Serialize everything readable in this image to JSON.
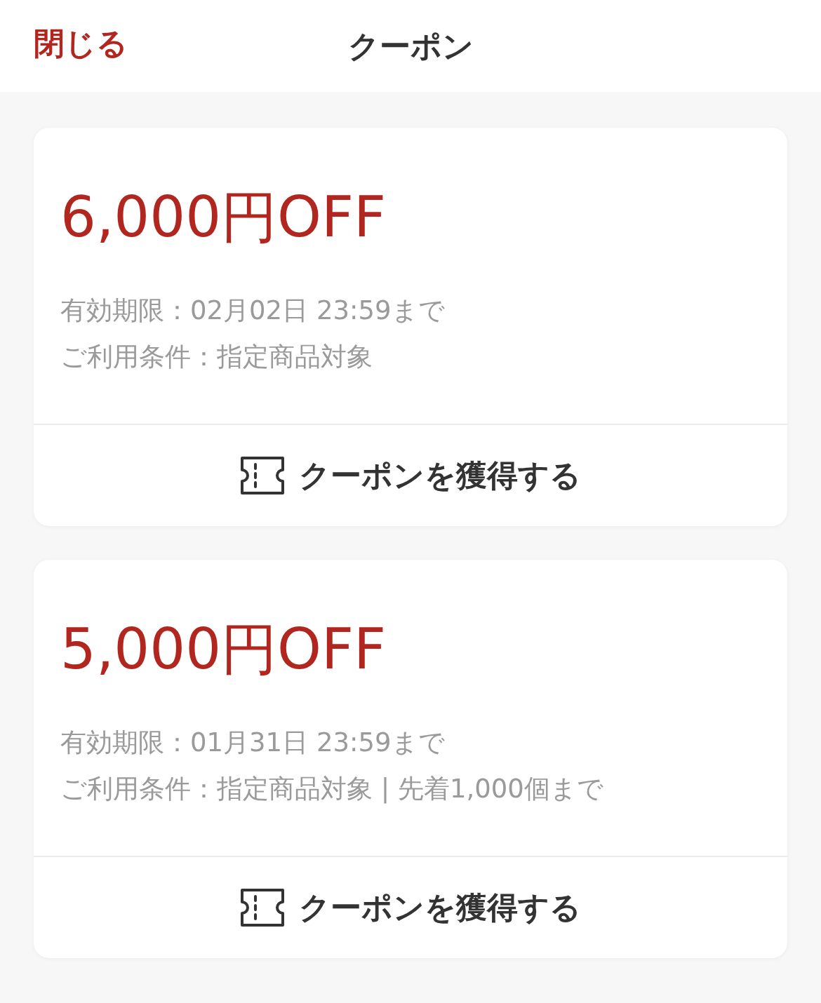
{
  "header": {
    "close": "閉じる",
    "title": "クーポン"
  },
  "coupons": [
    {
      "amount": "6,000円OFF",
      "expiry": "有効期限：02月02日 23:59まで",
      "conditions": "ご利用条件：指定商品対象",
      "button": "クーポンを獲得する"
    },
    {
      "amount": "5,000円OFF",
      "expiry": "有効期限：01月31日 23:59まで",
      "conditions": "ご利用条件：指定商品対象 | 先着1,000個まで",
      "button": "クーポンを獲得する"
    }
  ]
}
